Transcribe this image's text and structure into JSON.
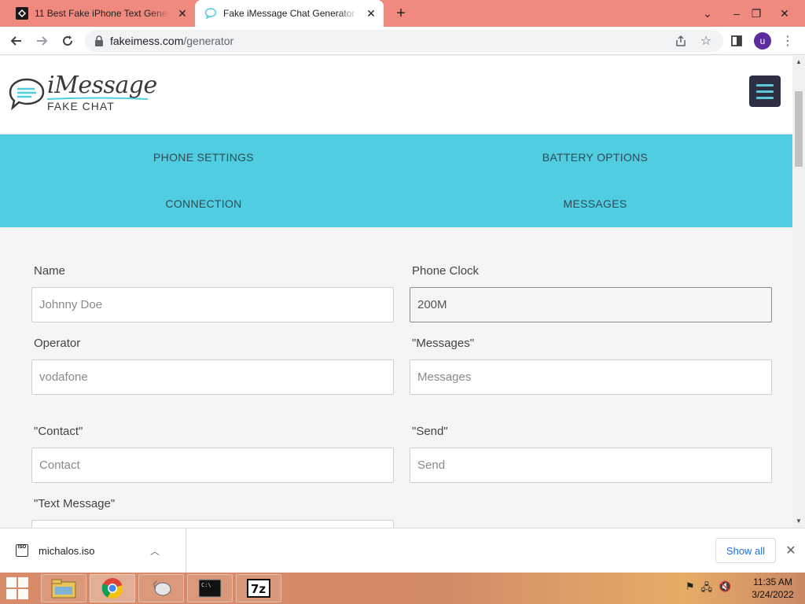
{
  "browser": {
    "tabs": [
      {
        "title": "11 Best Fake iPhone Text Generators",
        "active": false
      },
      {
        "title": "Fake iMessage Chat Generator | Fake",
        "active": true
      }
    ],
    "url": {
      "domain": "fakeimess.com",
      "path": "/generator"
    },
    "profile_initial": "u"
  },
  "site": {
    "logo_word": "iMessage",
    "logo_sub": "FAKE CHAT",
    "nav": [
      {
        "label": "PHONE SETTINGS"
      },
      {
        "label": "BATTERY OPTIONS"
      },
      {
        "label": "CONNECTION"
      },
      {
        "label": "MESSAGES"
      }
    ],
    "accent_color": "#50cde0"
  },
  "form": {
    "name": {
      "label": "Name",
      "placeholder": "Johnny Doe",
      "value": ""
    },
    "phone_clock": {
      "label": "Phone Clock",
      "placeholder": "",
      "value": "200M"
    },
    "operator": {
      "label": "Operator",
      "placeholder": "vodafone",
      "value": ""
    },
    "messages": {
      "label": "\"Messages\"",
      "placeholder": "Messages",
      "value": ""
    },
    "contact": {
      "label": "\"Contact\"",
      "placeholder": "Contact",
      "value": ""
    },
    "send": {
      "label": "\"Send\"",
      "placeholder": "Send",
      "value": ""
    },
    "text_message": {
      "label": "\"Text Message\"",
      "placeholder": "",
      "value": ""
    }
  },
  "downloads": {
    "file_name": "michalos.iso",
    "show_all_label": "Show all"
  },
  "taskbar": {
    "time": "11:35 AM",
    "date": "3/24/2022"
  }
}
